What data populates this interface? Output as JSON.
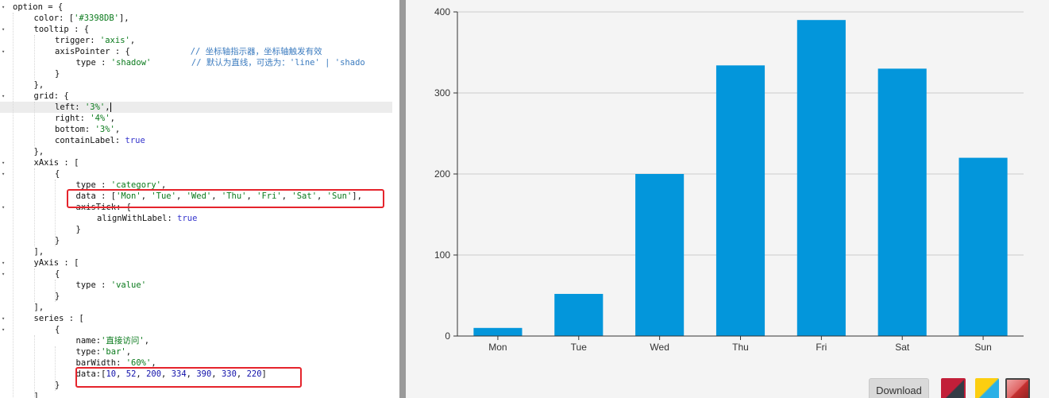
{
  "editor": {
    "lines": [
      {
        "fold": "▾",
        "indent": 0,
        "tokens": [
          [
            "t",
            "option = {"
          ]
        ]
      },
      {
        "fold": "",
        "indent": 1,
        "tokens": [
          [
            "t",
            "color: ["
          ],
          [
            "s",
            "'#3398DB'"
          ],
          [
            "t",
            "],"
          ]
        ]
      },
      {
        "fold": "▾",
        "indent": 1,
        "tokens": [
          [
            "t",
            "tooltip : {"
          ]
        ]
      },
      {
        "fold": "",
        "indent": 2,
        "tokens": [
          [
            "t",
            "trigger: "
          ],
          [
            "s",
            "'axis'"
          ],
          [
            "t",
            ","
          ]
        ]
      },
      {
        "fold": "▾",
        "indent": 2,
        "tokens": [
          [
            "t",
            "axisPointer : {            "
          ],
          [
            "c",
            "// 坐标轴指示器，坐标轴触发有效"
          ]
        ]
      },
      {
        "fold": "",
        "indent": 3,
        "tokens": [
          [
            "t",
            "type : "
          ],
          [
            "s",
            "'shadow'"
          ],
          [
            "t",
            "        "
          ],
          [
            "c",
            "// 默认为直线，可选为：'line' | 'shado"
          ]
        ]
      },
      {
        "fold": "",
        "indent": 2,
        "tokens": [
          [
            "t",
            "}"
          ]
        ]
      },
      {
        "fold": "",
        "indent": 1,
        "tokens": [
          [
            "t",
            "},"
          ]
        ]
      },
      {
        "fold": "▾",
        "indent": 1,
        "tokens": [
          [
            "t",
            "grid: {"
          ]
        ]
      },
      {
        "fold": "",
        "indent": 2,
        "tokens": [
          [
            "t",
            "left: "
          ],
          [
            "s",
            "'3%'"
          ],
          [
            "t",
            ","
          ],
          [
            "cursor",
            ""
          ]
        ]
      },
      {
        "fold": "",
        "indent": 2,
        "tokens": [
          [
            "t",
            "right: "
          ],
          [
            "s",
            "'4%'"
          ],
          [
            "t",
            ","
          ]
        ]
      },
      {
        "fold": "",
        "indent": 2,
        "tokens": [
          [
            "t",
            "bottom: "
          ],
          [
            "s",
            "'3%'"
          ],
          [
            "t",
            ","
          ]
        ]
      },
      {
        "fold": "",
        "indent": 2,
        "tokens": [
          [
            "t",
            "containLabel: "
          ],
          [
            "k",
            "true"
          ]
        ]
      },
      {
        "fold": "",
        "indent": 1,
        "tokens": [
          [
            "t",
            "},"
          ]
        ]
      },
      {
        "fold": "▾",
        "indent": 1,
        "tokens": [
          [
            "t",
            "xAxis : ["
          ]
        ]
      },
      {
        "fold": "▾",
        "indent": 2,
        "tokens": [
          [
            "t",
            "{"
          ]
        ]
      },
      {
        "fold": "",
        "indent": 3,
        "tokens": [
          [
            "t",
            "type : "
          ],
          [
            "s",
            "'category'"
          ],
          [
            "t",
            ","
          ]
        ]
      },
      {
        "fold": "",
        "indent": 3,
        "tokens": [
          [
            "t",
            "data : ["
          ],
          [
            "s",
            "'Mon'"
          ],
          [
            "t",
            ", "
          ],
          [
            "s",
            "'Tue'"
          ],
          [
            "t",
            ", "
          ],
          [
            "s",
            "'Wed'"
          ],
          [
            "t",
            ", "
          ],
          [
            "s",
            "'Thu'"
          ],
          [
            "t",
            ", "
          ],
          [
            "s",
            "'Fri'"
          ],
          [
            "t",
            ", "
          ],
          [
            "s",
            "'Sat'"
          ],
          [
            "t",
            ", "
          ],
          [
            "s",
            "'Sun'"
          ],
          [
            "t",
            "],"
          ]
        ]
      },
      {
        "fold": "▾",
        "indent": 3,
        "tokens": [
          [
            "t",
            "axisTick: {"
          ]
        ]
      },
      {
        "fold": "",
        "indent": 4,
        "tokens": [
          [
            "t",
            "alignWithLabel: "
          ],
          [
            "k",
            "true"
          ]
        ]
      },
      {
        "fold": "",
        "indent": 3,
        "tokens": [
          [
            "t",
            "}"
          ]
        ]
      },
      {
        "fold": "",
        "indent": 2,
        "tokens": [
          [
            "t",
            "}"
          ]
        ]
      },
      {
        "fold": "",
        "indent": 1,
        "tokens": [
          [
            "t",
            "],"
          ]
        ]
      },
      {
        "fold": "▾",
        "indent": 1,
        "tokens": [
          [
            "t",
            "yAxis : ["
          ]
        ]
      },
      {
        "fold": "▾",
        "indent": 2,
        "tokens": [
          [
            "t",
            "{"
          ]
        ]
      },
      {
        "fold": "",
        "indent": 3,
        "tokens": [
          [
            "t",
            "type : "
          ],
          [
            "s",
            "'value'"
          ]
        ]
      },
      {
        "fold": "",
        "indent": 2,
        "tokens": [
          [
            "t",
            "}"
          ]
        ]
      },
      {
        "fold": "",
        "indent": 1,
        "tokens": [
          [
            "t",
            "],"
          ]
        ]
      },
      {
        "fold": "▾",
        "indent": 1,
        "tokens": [
          [
            "t",
            "series : ["
          ]
        ]
      },
      {
        "fold": "▾",
        "indent": 2,
        "tokens": [
          [
            "t",
            "{"
          ]
        ]
      },
      {
        "fold": "",
        "indent": 3,
        "tokens": [
          [
            "t",
            "name:"
          ],
          [
            "s",
            "'直接访问'"
          ],
          [
            "t",
            ","
          ]
        ]
      },
      {
        "fold": "",
        "indent": 3,
        "tokens": [
          [
            "t",
            "type:"
          ],
          [
            "s",
            "'bar'"
          ],
          [
            "t",
            ","
          ]
        ]
      },
      {
        "fold": "",
        "indent": 3,
        "tokens": [
          [
            "t",
            "barWidth: "
          ],
          [
            "s",
            "'60%'"
          ],
          [
            "t",
            ","
          ]
        ]
      },
      {
        "fold": "",
        "indent": 3,
        "tokens": [
          [
            "t",
            "data:["
          ],
          [
            "n",
            "10"
          ],
          [
            "t",
            ", "
          ],
          [
            "n",
            "52"
          ],
          [
            "t",
            ", "
          ],
          [
            "n",
            "200"
          ],
          [
            "t",
            ", "
          ],
          [
            "n",
            "334"
          ],
          [
            "t",
            ", "
          ],
          [
            "n",
            "390"
          ],
          [
            "t",
            ", "
          ],
          [
            "n",
            "330"
          ],
          [
            "t",
            ", "
          ],
          [
            "n",
            "220"
          ],
          [
            "t",
            "]"
          ]
        ]
      },
      {
        "fold": "",
        "indent": 2,
        "tokens": [
          [
            "t",
            "}"
          ]
        ]
      },
      {
        "fold": "",
        "indent": 1,
        "tokens": [
          [
            "t",
            "]"
          ]
        ]
      }
    ]
  },
  "chart_data": {
    "type": "bar",
    "categories": [
      "Mon",
      "Tue",
      "Wed",
      "Thu",
      "Fri",
      "Sat",
      "Sun"
    ],
    "series": [
      {
        "values": [
          10,
          52,
          200,
          334,
          390,
          330,
          220
        ]
      }
    ],
    "yticks": [
      "0",
      "100",
      "200",
      "300",
      "400"
    ],
    "ylim": [
      0,
      400
    ],
    "grid": true,
    "bar_color": "#0396db",
    "title": "",
    "xlabel": "",
    "ylabel": ""
  },
  "toolbar": {
    "download_label": "Download"
  },
  "colors": {
    "highlight": "#e5242c",
    "bar": "#0396db"
  }
}
